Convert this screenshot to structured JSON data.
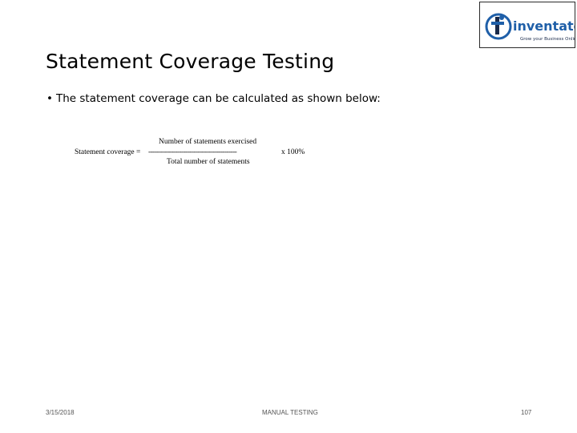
{
  "logo": {
    "brand": "inventateq",
    "tagline": "Grow your Business Online",
    "colors": {
      "blue": "#1f5fa8",
      "dark": "#1a2a4a"
    }
  },
  "slide": {
    "title": "Statement Coverage Testing",
    "bullet": "The statement coverage can be calculated as shown below:"
  },
  "formula": {
    "numerator": "Number of statements exercised",
    "lhs": "Statement coverage =",
    "divider": "-------------------------------------------",
    "multiplier": "x 100%",
    "denominator": "Total number of statements"
  },
  "footer": {
    "date": "3/15/2018",
    "center": "MANUAL TESTING",
    "page": "107"
  }
}
